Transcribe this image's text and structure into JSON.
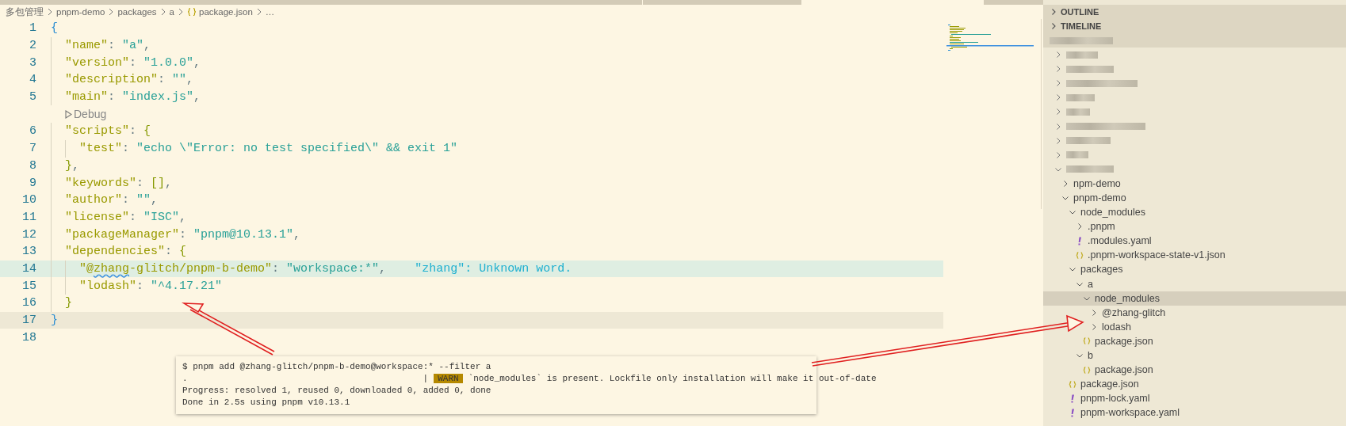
{
  "breadcrumb": [
    {
      "kind": "folder",
      "label": "多包管理"
    },
    {
      "kind": "folder",
      "label": "pnpm-demo"
    },
    {
      "kind": "folder",
      "label": "packages"
    },
    {
      "kind": "folder",
      "label": "a"
    },
    {
      "kind": "json-file",
      "label": "package.json"
    },
    {
      "kind": "more",
      "label": "…"
    }
  ],
  "editor": {
    "lines": [
      {
        "kind": "code",
        "number": "1",
        "tokens": [
          {
            "kind": "brace-outer",
            "text": "{"
          }
        ]
      },
      {
        "kind": "code",
        "number": "2",
        "tokens": [
          {
            "kind": "indent"
          },
          {
            "kind": "key",
            "text": "\"name\""
          },
          {
            "kind": "punct",
            "text": ": "
          },
          {
            "kind": "string",
            "text": "\"a\""
          },
          {
            "kind": "punct",
            "text": ","
          }
        ]
      },
      {
        "kind": "code",
        "number": "3",
        "tokens": [
          {
            "kind": "indent"
          },
          {
            "kind": "key",
            "text": "\"version\""
          },
          {
            "kind": "punct",
            "text": ": "
          },
          {
            "kind": "string",
            "text": "\"1.0.0\""
          },
          {
            "kind": "punct",
            "text": ","
          }
        ]
      },
      {
        "kind": "code",
        "number": "4",
        "tokens": [
          {
            "kind": "indent"
          },
          {
            "kind": "key",
            "text": "\"description\""
          },
          {
            "kind": "punct",
            "text": ": "
          },
          {
            "kind": "string",
            "text": "\"\""
          },
          {
            "kind": "punct",
            "text": ","
          }
        ]
      },
      {
        "kind": "code",
        "number": "5",
        "tokens": [
          {
            "kind": "indent"
          },
          {
            "kind": "key",
            "text": "\"main\""
          },
          {
            "kind": "punct",
            "text": ": "
          },
          {
            "kind": "string",
            "text": "\"index.js\""
          },
          {
            "kind": "punct",
            "text": ","
          }
        ]
      },
      {
        "kind": "codelens",
        "label": "Debug"
      },
      {
        "kind": "code",
        "number": "6",
        "tokens": [
          {
            "kind": "indent"
          },
          {
            "kind": "key",
            "text": "\"scripts\""
          },
          {
            "kind": "punct",
            "text": ": "
          },
          {
            "kind": "brace",
            "text": "{"
          }
        ]
      },
      {
        "kind": "code",
        "number": "7",
        "tokens": [
          {
            "kind": "indent"
          },
          {
            "kind": "indent"
          },
          {
            "kind": "key",
            "text": "\"test\""
          },
          {
            "kind": "punct",
            "text": ": "
          },
          {
            "kind": "string",
            "text": "\"echo \\\"Error: no test specified\\\" && exit 1\""
          }
        ]
      },
      {
        "kind": "code",
        "number": "8",
        "tokens": [
          {
            "kind": "indent"
          },
          {
            "kind": "brace",
            "text": "}"
          },
          {
            "kind": "punct",
            "text": ","
          }
        ]
      },
      {
        "kind": "code",
        "number": "9",
        "tokens": [
          {
            "kind": "indent"
          },
          {
            "kind": "key",
            "text": "\"keywords\""
          },
          {
            "kind": "punct",
            "text": ": "
          },
          {
            "kind": "brace",
            "text": "[]"
          },
          {
            "kind": "punct",
            "text": ","
          }
        ]
      },
      {
        "kind": "code",
        "number": "10",
        "tokens": [
          {
            "kind": "indent"
          },
          {
            "kind": "key",
            "text": "\"author\""
          },
          {
            "kind": "punct",
            "text": ": "
          },
          {
            "kind": "string",
            "text": "\"\""
          },
          {
            "kind": "punct",
            "text": ","
          }
        ]
      },
      {
        "kind": "code",
        "number": "11",
        "tokens": [
          {
            "kind": "indent"
          },
          {
            "kind": "key",
            "text": "\"license\""
          },
          {
            "kind": "punct",
            "text": ": "
          },
          {
            "kind": "string",
            "text": "\"ISC\""
          },
          {
            "kind": "punct",
            "text": ","
          }
        ]
      },
      {
        "kind": "code",
        "number": "12",
        "tokens": [
          {
            "kind": "indent"
          },
          {
            "kind": "key",
            "text": "\"packageManager\""
          },
          {
            "kind": "punct",
            "text": ": "
          },
          {
            "kind": "string",
            "text": "\"pnpm@10.13.1\""
          },
          {
            "kind": "punct",
            "text": ","
          }
        ]
      },
      {
        "kind": "code",
        "number": "13",
        "tokens": [
          {
            "kind": "indent"
          },
          {
            "kind": "key",
            "text": "\"dependencies\""
          },
          {
            "kind": "punct",
            "text": ": "
          },
          {
            "kind": "brace",
            "text": "{"
          }
        ]
      },
      {
        "kind": "code",
        "number": "14",
        "highlighted": true,
        "tokens": [
          {
            "kind": "indent"
          },
          {
            "kind": "indent"
          },
          {
            "kind": "key",
            "text": "\"@"
          },
          {
            "kind": "key-misspelled",
            "text": "zhang"
          },
          {
            "kind": "key",
            "text": "-glitch/pnpm-b-demo\""
          },
          {
            "kind": "punct",
            "text": ": "
          },
          {
            "kind": "string",
            "text": "\"workspace:*\""
          },
          {
            "kind": "punct",
            "text": ","
          },
          {
            "kind": "hint",
            "text": "\"zhang\": Unknown word."
          }
        ]
      },
      {
        "kind": "code",
        "number": "15",
        "tokens": [
          {
            "kind": "indent"
          },
          {
            "kind": "indent"
          },
          {
            "kind": "key",
            "text": "\"lodash\""
          },
          {
            "kind": "punct",
            "text": ": "
          },
          {
            "kind": "string",
            "text": "\"^4.17.21\""
          }
        ]
      },
      {
        "kind": "code",
        "number": "16",
        "tokens": [
          {
            "kind": "indent"
          },
          {
            "kind": "brace",
            "text": "}"
          }
        ]
      },
      {
        "kind": "code",
        "number": "17",
        "current": true,
        "tokens": [
          {
            "kind": "brace-outer",
            "text": "}"
          }
        ]
      },
      {
        "kind": "code",
        "number": "18"
      }
    ]
  },
  "sidebar": {
    "sections": [
      {
        "title": "OUTLINE",
        "expanded": false
      },
      {
        "title": "TIMELINE",
        "expanded": false
      }
    ],
    "tree": [
      {
        "kind": "redacted",
        "expanded": false
      },
      {
        "kind": "redacted",
        "expanded": false
      },
      {
        "kind": "redacted",
        "expanded": false
      },
      {
        "kind": "redacted",
        "expanded": false
      },
      {
        "kind": "redacted",
        "expanded": false
      },
      {
        "kind": "redacted",
        "expanded": false
      },
      {
        "kind": "redacted",
        "expanded": false
      },
      {
        "kind": "redacted",
        "expanded": false
      },
      {
        "kind": "redacted",
        "expanded": true,
        "children": [
          {
            "kind": "folder",
            "label": "npm-demo",
            "expanded": false,
            "selected": false
          },
          {
            "kind": "folder",
            "label": "pnpm-demo",
            "expanded": true,
            "selected": false,
            "children": [
              {
                "kind": "folder",
                "label": "node_modules",
                "expanded": true,
                "selected": false,
                "children": [
                  {
                    "kind": "folder",
                    "label": ".pnpm",
                    "expanded": false,
                    "selected": false
                  },
                  {
                    "kind": "yaml-file",
                    "label": ".modules.yaml",
                    "selected": false
                  },
                  {
                    "kind": "json-file",
                    "label": ".pnpm-workspace-state-v1.json",
                    "selected": false
                  }
                ]
              },
              {
                "kind": "folder",
                "label": "packages",
                "expanded": true,
                "selected": false,
                "children": [
                  {
                    "kind": "folder",
                    "label": "a",
                    "expanded": true,
                    "selected": false,
                    "children": [
                      {
                        "kind": "folder",
                        "label": "node_modules",
                        "expanded": true,
                        "selected": true,
                        "children": [
                          {
                            "kind": "folder",
                            "label": "@zhang-glitch",
                            "expanded": false,
                            "selected": false
                          },
                          {
                            "kind": "folder",
                            "label": "lodash",
                            "expanded": false,
                            "selected": false
                          }
                        ]
                      },
                      {
                        "kind": "json-file",
                        "label": "package.json",
                        "selected": false
                      }
                    ]
                  },
                  {
                    "kind": "folder",
                    "label": "b",
                    "expanded": true,
                    "selected": false,
                    "children": [
                      {
                        "kind": "json-file",
                        "label": "package.json",
                        "selected": false
                      }
                    ]
                  }
                ]
              },
              {
                "kind": "json-file",
                "label": "package.json",
                "selected": false
              },
              {
                "kind": "yaml-file",
                "label": "pnpm-lock.yaml",
                "selected": false
              },
              {
                "kind": "yaml-file",
                "label": "pnpm-workspace.yaml",
                "selected": false
              }
            ]
          }
        ]
      }
    ]
  },
  "terminal": {
    "lines": [
      [
        {
          "kind": "text",
          "text": "$ pnpm add @zhang-glitch/pnpm-b-demo@workspace:* --filter a"
        }
      ],
      [
        {
          "kind": "text",
          "text": "."
        },
        {
          "kind": "pipe",
          "text": "|"
        },
        {
          "kind": "badge",
          "text": "WARN"
        },
        {
          "kind": "text",
          "text": "`node_modules` is present. Lockfile only installation will make it out-of-date"
        }
      ],
      [
        {
          "kind": "text",
          "text": "Progress: resolved 1, reused 0, downloaded 0, added 0, done"
        }
      ],
      [
        {
          "kind": "text",
          "text": "Done in 2.5s using pnpm v10.13.1"
        }
      ]
    ]
  }
}
